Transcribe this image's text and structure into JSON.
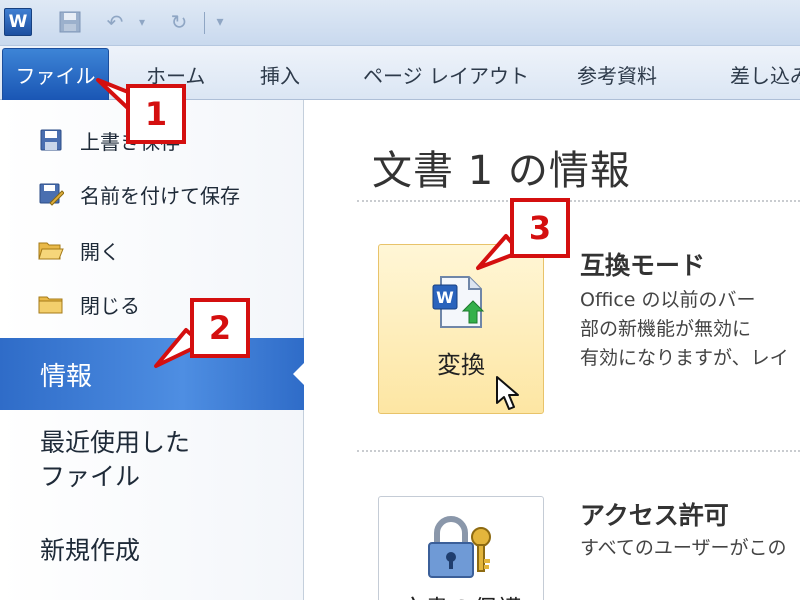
{
  "quick_access": {
    "app_icon_letter": "W",
    "save_icon": "save-icon",
    "undo_icon": "undo-icon",
    "redo_icon": "redo-icon",
    "customize_icon": "customize-qat-icon"
  },
  "ribbon": {
    "file_tab": "ファイル",
    "tabs": [
      "ホーム",
      "挿入",
      "ページ レイアウト",
      "参考資料",
      "差し込み"
    ]
  },
  "backstage": {
    "commands": [
      {
        "label": "上書き保存",
        "icon": "save-icon"
      },
      {
        "label": "名前を付けて保存",
        "icon": "save-as-icon"
      },
      {
        "label": "開く",
        "icon": "open-folder-icon"
      },
      {
        "label": "閉じる",
        "icon": "close-folder-icon"
      }
    ],
    "selected": "情報",
    "recent_line1": "最近使用した",
    "recent_line2": "ファイル",
    "new": "新規作成"
  },
  "info": {
    "title": "文書 1 の情報",
    "convert_button": "変換",
    "compat_title": "互換モード",
    "compat_lines": [
      "Office の以前のバー",
      "部の新機能が無効に",
      "有効になりますが、レイ"
    ],
    "protect_button": "文書の保護",
    "access_title": "アクセス許可",
    "access_line": "すべてのユーザーがこの"
  },
  "callouts": [
    "1",
    "2",
    "3"
  ],
  "colors": {
    "accent": "#2b66c4",
    "callout": "#d40f0f",
    "highlight": "#fde6a3"
  }
}
